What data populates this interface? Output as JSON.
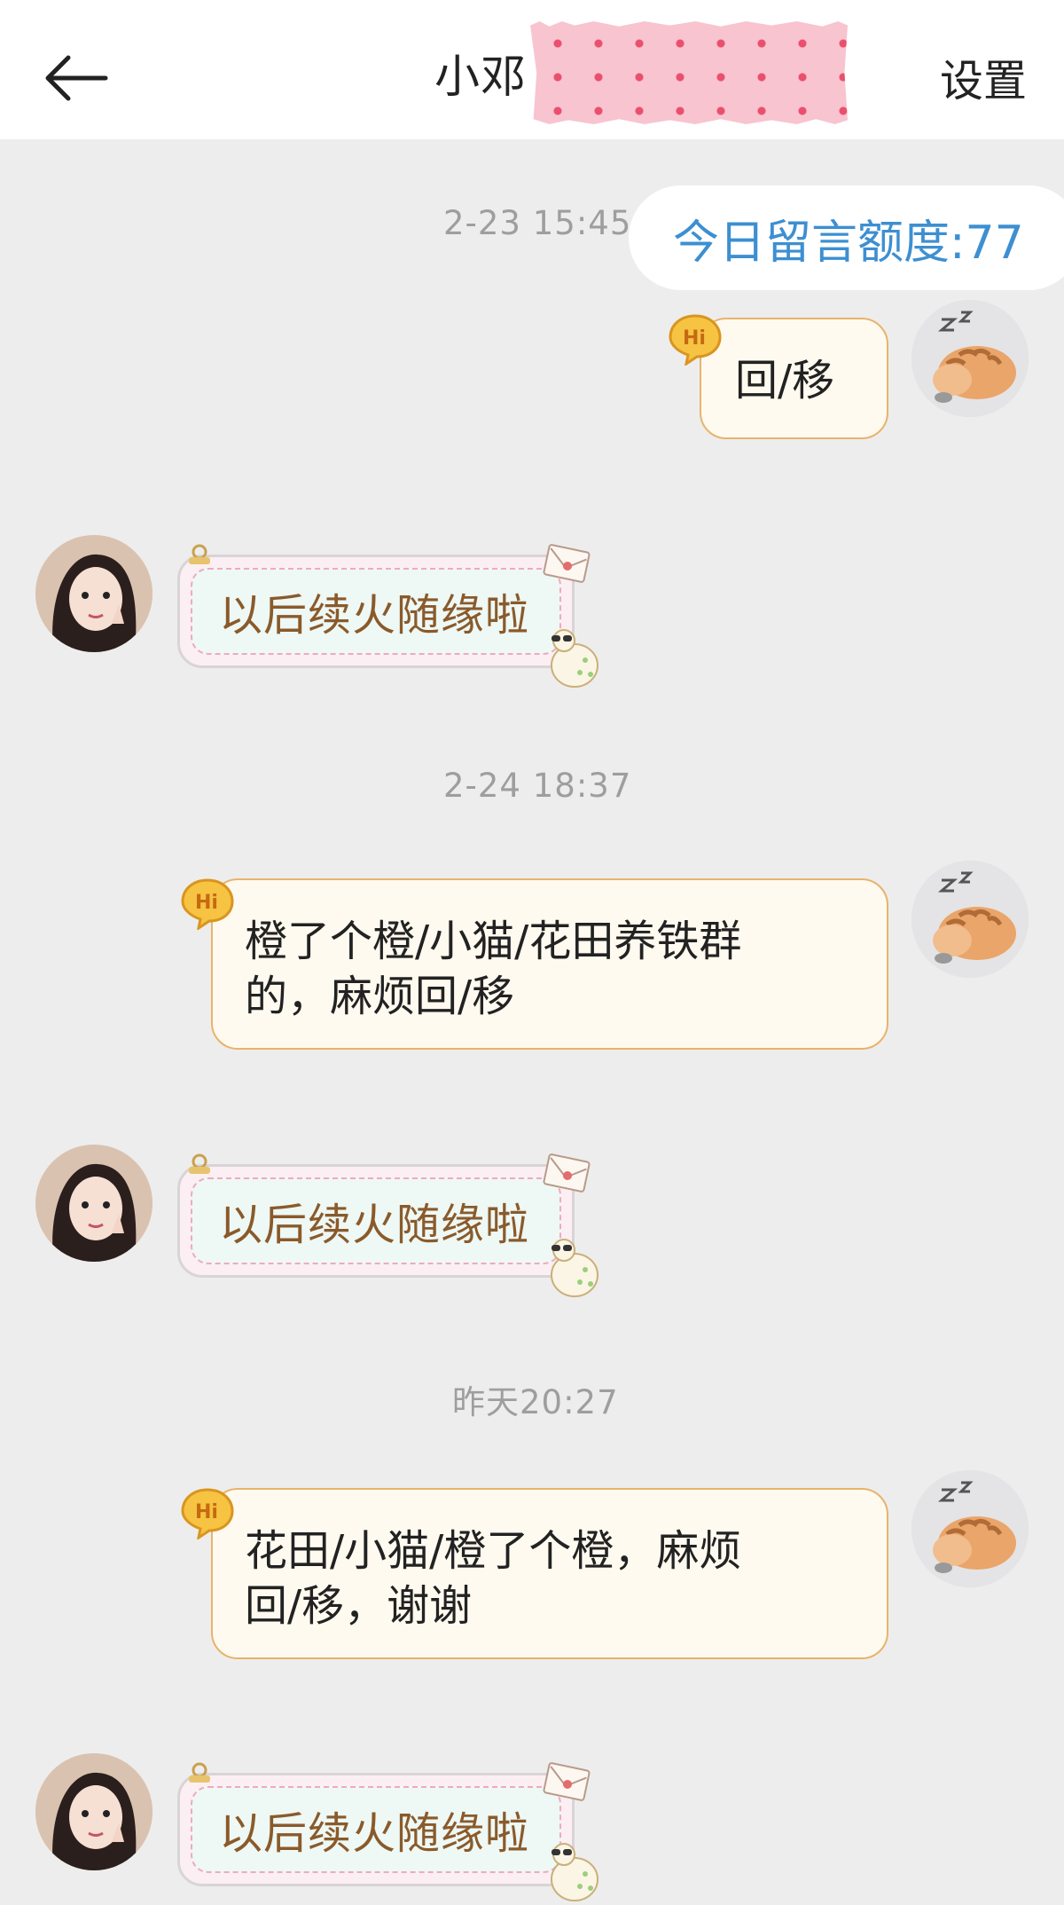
{
  "header": {
    "back_icon": "arrow-left-icon",
    "title": "小邓",
    "settings_label": "设置"
  },
  "quota": {
    "text": "今日留言额度:77"
  },
  "messages": [
    {
      "timestamp": "2-23 15:45"
    },
    {
      "direction": "outgoing",
      "text": "回/移",
      "badge": "Hi"
    },
    {
      "direction": "incoming",
      "text": "以后续火随缘啦"
    },
    {
      "timestamp": "2-24 18:37"
    },
    {
      "direction": "outgoing",
      "lines": [
        "橙了个橙/小猫/花田养铁群",
        "的，麻烦回/移"
      ],
      "badge": "Hi"
    },
    {
      "direction": "incoming",
      "text": "以后续火随缘啦"
    },
    {
      "timestamp": "昨天20:27"
    },
    {
      "direction": "outgoing",
      "lines": [
        "花田/小猫/橙了个橙，麻烦",
        "回/移，谢谢"
      ],
      "badge": "Hi"
    },
    {
      "direction": "incoming",
      "text": "以后续火随缘啦"
    }
  ],
  "colors": {
    "background": "#ededed",
    "quota_text": "#3d8fd1",
    "outgoing_border": "#e8b36c",
    "incoming_text": "#8a5a2b",
    "timestamp": "#9e9e9e"
  }
}
